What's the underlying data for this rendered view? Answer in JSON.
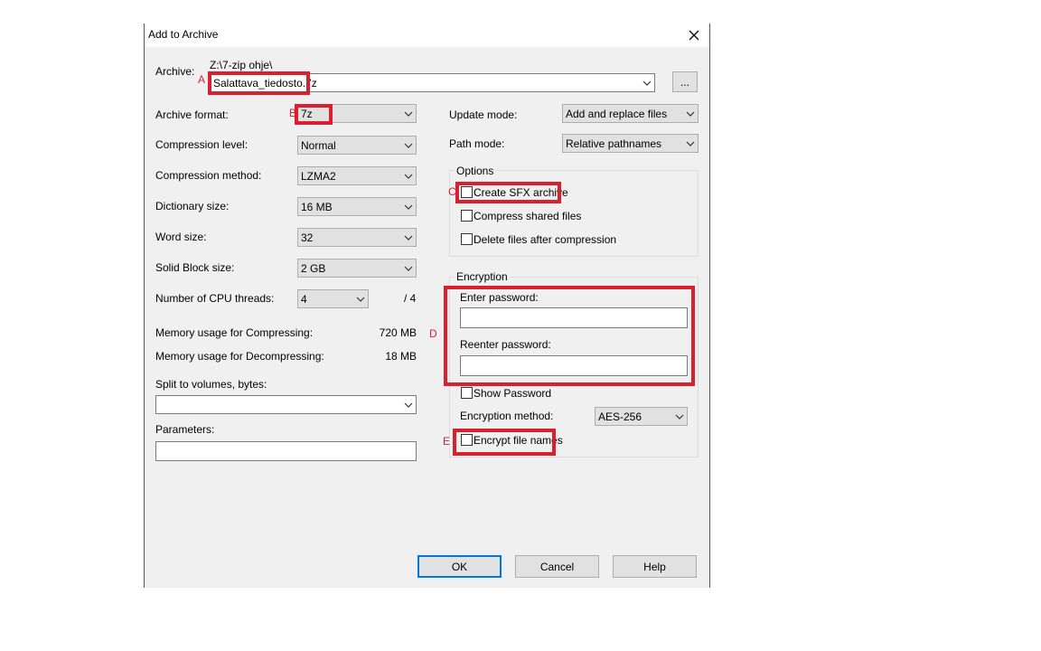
{
  "dialog": {
    "title": "Add to Archive",
    "archive_label": "Archive:",
    "archive_path": "Z:\\7-zip ohje\\",
    "archive_name": "Salattava_tiedosto.7z",
    "browse_label": "...",
    "left": {
      "format_label": "Archive format:",
      "format_value": "7z",
      "level_label": "Compression level:",
      "level_value": "Normal",
      "method_label": "Compression method:",
      "method_value": "LZMA2",
      "dict_label": "Dictionary size:",
      "dict_value": "16 MB",
      "word_label": "Word size:",
      "word_value": "32",
      "solid_label": "Solid Block size:",
      "solid_value": "2 GB",
      "cpu_label": "Number of CPU threads:",
      "cpu_value": "4",
      "cpu_total": "/ 4",
      "mem_comp_label": "Memory usage for Compressing:",
      "mem_comp_value": "720 MB",
      "mem_decomp_label": "Memory usage for Decompressing:",
      "mem_decomp_value": "18 MB",
      "split_label": "Split to volumes, bytes:",
      "split_value": "",
      "params_label": "Parameters:",
      "params_value": ""
    },
    "right": {
      "update_label": "Update mode:",
      "update_value": "Add and replace files",
      "path_label": "Path mode:",
      "path_value": "Relative pathnames",
      "options_title": "Options",
      "sfx_label": "Create SFX archive",
      "shared_label": "Compress shared files",
      "delete_label": "Delete files after compression",
      "encryption_title": "Encryption",
      "enter_pw_label": "Enter password:",
      "reenter_pw_label": "Reenter password:",
      "show_pw_label": "Show Password",
      "enc_method_label": "Encryption method:",
      "enc_method_value": "AES-256",
      "encrypt_names_label": "Encrypt file names"
    },
    "buttons": {
      "ok": "OK",
      "cancel": "Cancel",
      "help": "Help"
    }
  },
  "markers": {
    "a": "A",
    "b": "B",
    "c": "C",
    "d": "D",
    "e": "E"
  },
  "colors": {
    "highlight": "#d9202e",
    "dialog_bg": "#f0f0f0",
    "default_button_border": "#0078d7"
  },
  "icons": {
    "close": "close-icon",
    "dropdown": "chevron-down-icon"
  }
}
